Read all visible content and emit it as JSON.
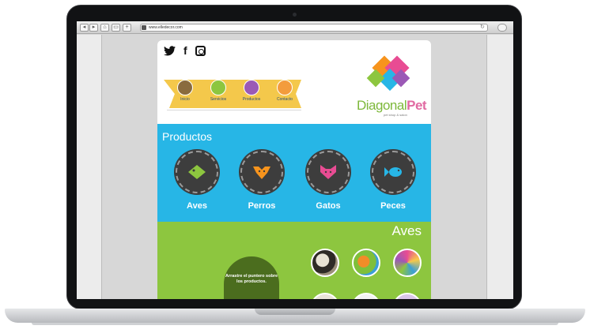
{
  "browser": {
    "url": "www.elledecor.com"
  },
  "site": {
    "brand_part1": "Diagonal",
    "brand_part2": "Pet",
    "tagline": "pet shop & salon",
    "menu": [
      {
        "label": "Inicio",
        "color": "#8a6b3e"
      },
      {
        "label": "Servicios",
        "color": "#8dc63f"
      },
      {
        "label": "Productos",
        "color": "#9b59b6"
      },
      {
        "label": "Contacto",
        "color": "#f39c3d"
      }
    ],
    "products_title": "Productos",
    "products": [
      {
        "label": "Aves",
        "icon": "bird-icon",
        "color": "#8dc63f"
      },
      {
        "label": "Perros",
        "icon": "dog-icon",
        "color": "#f7941d"
      },
      {
        "label": "Gatos",
        "icon": "cat-icon",
        "color": "#e84c93"
      },
      {
        "label": "Peces",
        "icon": "fish-icon",
        "color": "#27b6e6"
      }
    ],
    "section_title": "Aves",
    "hover_hint": "Arrastre el puntero sobre los productos."
  }
}
